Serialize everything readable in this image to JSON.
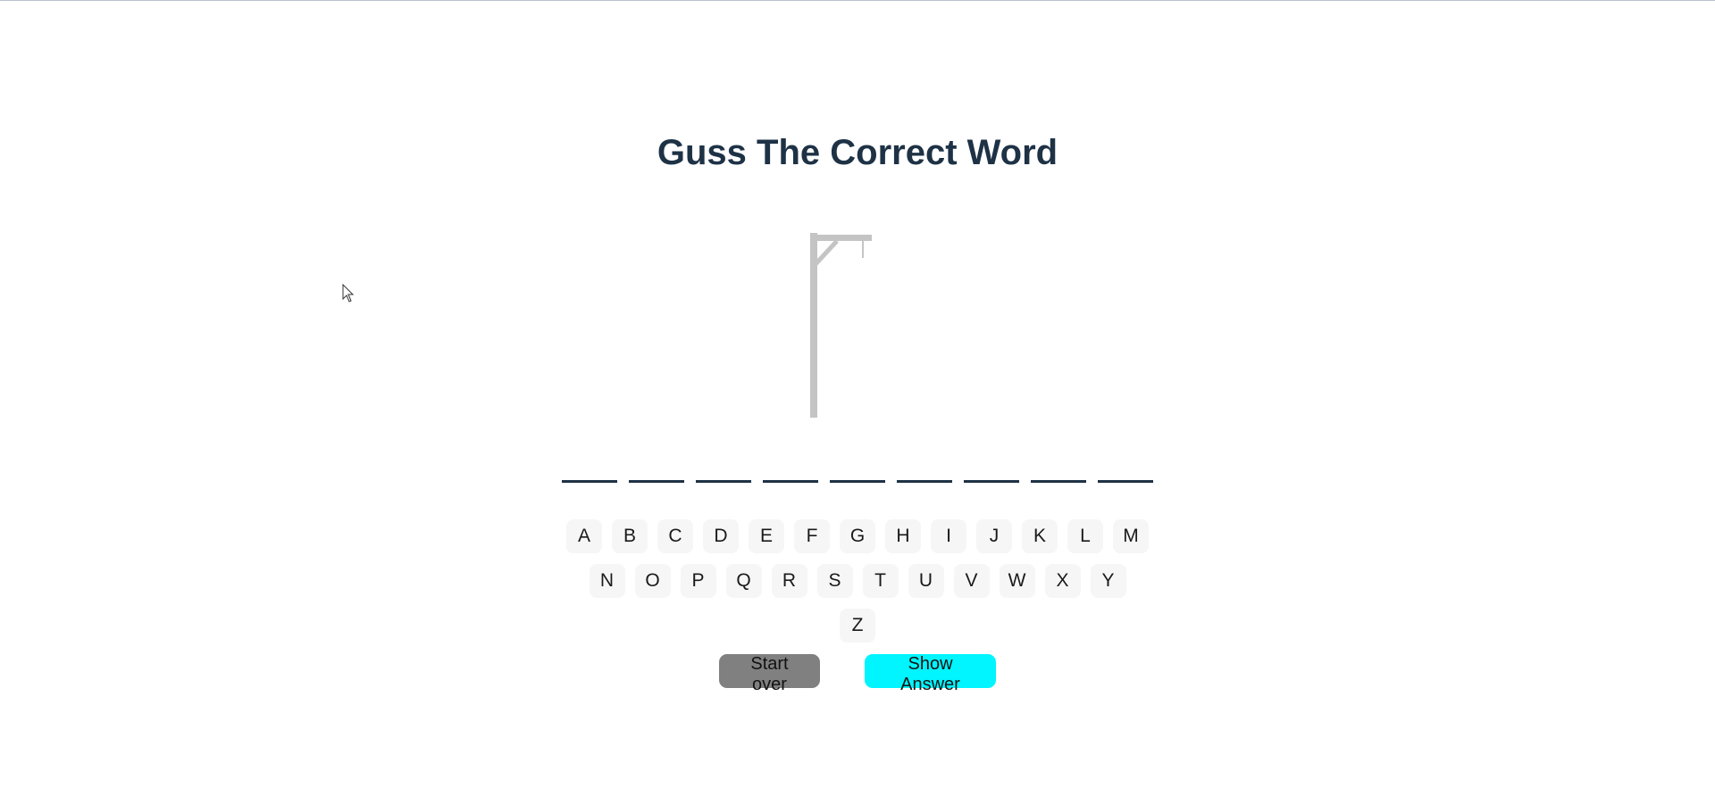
{
  "title": "Guss The Correct Word",
  "word": {
    "slots": 9
  },
  "keyboard": {
    "row1": [
      "A",
      "B",
      "C",
      "D",
      "E",
      "F",
      "G",
      "H",
      "I",
      "J",
      "K",
      "L",
      "M"
    ],
    "row2": [
      "N",
      "O",
      "P",
      "Q",
      "R",
      "S",
      "T",
      "U",
      "V",
      "W",
      "X",
      "Y"
    ],
    "row3": [
      "Z"
    ]
  },
  "controls": {
    "start_over_label": "Start over",
    "show_answer_label": "Show Answer"
  },
  "colors": {
    "title": "#1e3246",
    "gallows": "#c4c4c4",
    "start_over_bg": "#808080",
    "show_answer_bg": "#00f5ff",
    "key_bg": "#f6f6f6"
  },
  "icons": {
    "cursor": "mouse-pointer-icon"
  }
}
